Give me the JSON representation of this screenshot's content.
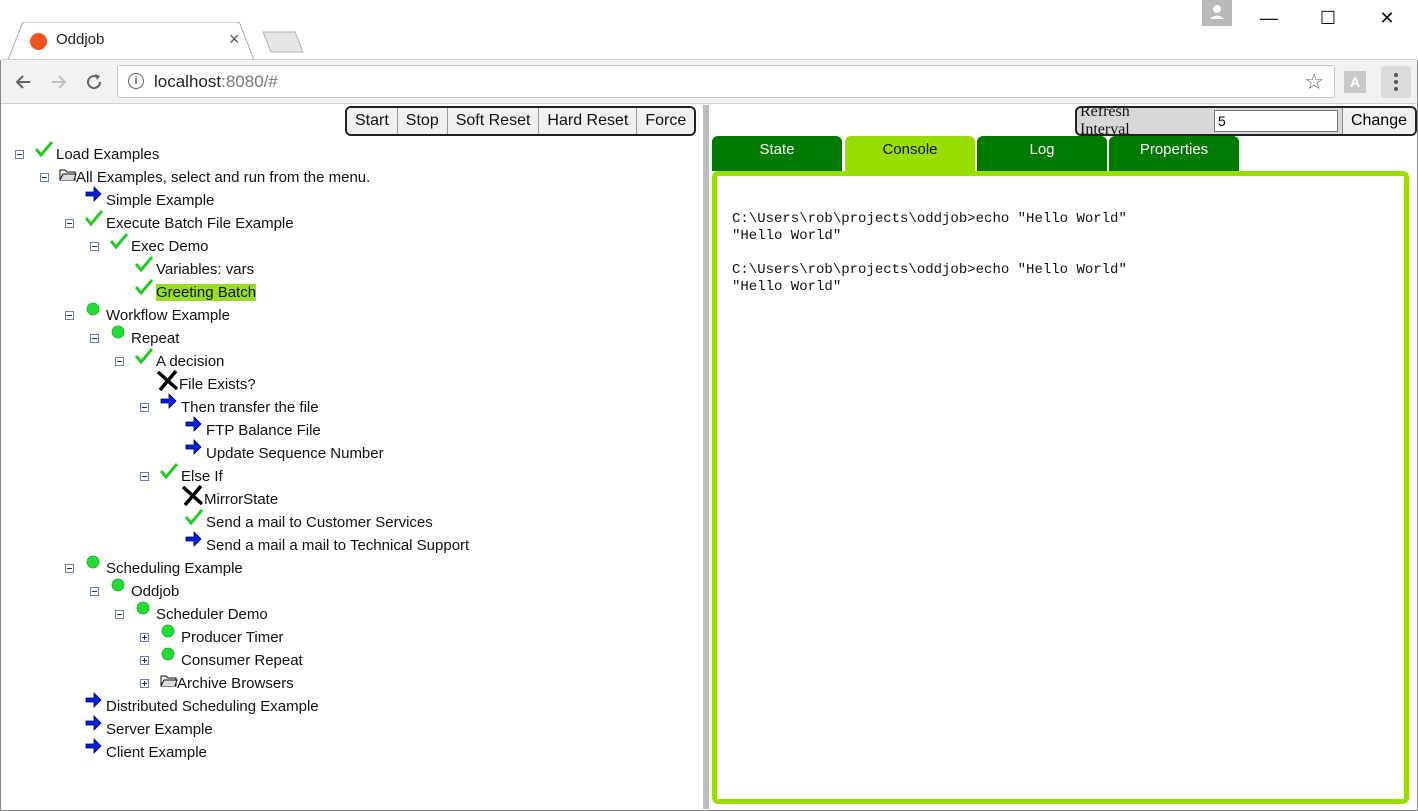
{
  "browser": {
    "tab_title": "Oddjob",
    "tab_close": "×",
    "url_host": "localhost",
    "url_rest": ":8080/#",
    "pdf_label": "A"
  },
  "window": {
    "minimize": "—",
    "maximize": "☐",
    "close": "✕"
  },
  "job_controls": [
    "Start",
    "Stop",
    "Soft Reset",
    "Hard Reset",
    "Force"
  ],
  "tree": [
    {
      "label": "Load Examples",
      "icon": "check-icon",
      "toggle": "minus",
      "selected": false
    },
    {
      "label": "All Examples, select and run from the menu.",
      "icon": "folder-icon",
      "toggle": "minus",
      "selected": false
    },
    {
      "label": "Simple Example",
      "icon": "arrow-icon",
      "toggle": "",
      "selected": false
    },
    {
      "label": "Execute Batch File Example",
      "icon": "check-icon",
      "toggle": "minus",
      "selected": false
    },
    {
      "label": "Exec Demo",
      "icon": "check-icon",
      "toggle": "minus",
      "selected": false
    },
    {
      "label": "Variables: vars",
      "icon": "check-icon",
      "toggle": "",
      "selected": false
    },
    {
      "label": "Greeting Batch",
      "icon": "check-icon",
      "toggle": "",
      "selected": true
    },
    {
      "label": "Workflow Example",
      "icon": "green-dot-icon",
      "toggle": "minus",
      "selected": false
    },
    {
      "label": "Repeat",
      "icon": "green-dot-icon",
      "toggle": "minus",
      "selected": false
    },
    {
      "label": "A decision",
      "icon": "check-icon",
      "toggle": "minus",
      "selected": false
    },
    {
      "label": "File Exists?",
      "icon": "cross-icon",
      "toggle": "",
      "selected": false
    },
    {
      "label": "Then transfer the file",
      "icon": "arrow-icon",
      "toggle": "minus",
      "selected": false
    },
    {
      "label": "FTP Balance File",
      "icon": "arrow-icon",
      "toggle": "",
      "selected": false
    },
    {
      "label": "Update Sequence Number",
      "icon": "arrow-icon",
      "toggle": "",
      "selected": false
    },
    {
      "label": "Else If",
      "icon": "check-icon",
      "toggle": "minus",
      "selected": false
    },
    {
      "label": "MirrorState",
      "icon": "cross-icon",
      "toggle": "",
      "selected": false
    },
    {
      "label": "Send a mail to Customer Services",
      "icon": "check-icon",
      "toggle": "",
      "selected": false
    },
    {
      "label": "Send a mail a mail to Technical Support",
      "icon": "arrow-icon",
      "toggle": "",
      "selected": false
    },
    {
      "label": "Scheduling Example",
      "icon": "green-dot-icon",
      "toggle": "minus",
      "selected": false
    },
    {
      "label": "Oddjob",
      "icon": "green-dot-icon",
      "toggle": "minus",
      "selected": false
    },
    {
      "label": "Scheduler Demo",
      "icon": "green-dot-icon",
      "toggle": "minus",
      "selected": false
    },
    {
      "label": "Producer Timer",
      "icon": "green-dot-icon",
      "toggle": "plus",
      "selected": false
    },
    {
      "label": "Consumer Repeat",
      "icon": "green-dot-icon",
      "toggle": "plus",
      "selected": false
    },
    {
      "label": "Archive Browsers",
      "icon": "folder-icon",
      "toggle": "plus",
      "selected": false
    },
    {
      "label": "Distributed Scheduling Example",
      "icon": "arrow-icon",
      "toggle": "",
      "selected": false
    },
    {
      "label": "Server Example",
      "icon": "arrow-icon",
      "toggle": "",
      "selected": false
    },
    {
      "label": "Client Example",
      "icon": "arrow-icon",
      "toggle": "",
      "selected": false
    }
  ],
  "refresh": {
    "label": "Refresh Interval",
    "value": "5",
    "button": "Change"
  },
  "detail_tabs": [
    {
      "label": "State",
      "active": false
    },
    {
      "label": "Console",
      "active": true
    },
    {
      "label": "Log",
      "active": false
    },
    {
      "label": "Properties",
      "active": false
    }
  ],
  "console_output": "C:\\Users\\rob\\projects\\oddjob>echo \"Hello World\"\n\"Hello World\"\n\nC:\\Users\\rob\\projects\\oddjob>echo \"Hello World\"\n\"Hello World\"",
  "colors": {
    "check": "#22cc22",
    "dot": "#22dd33",
    "arrow": "#0022dd",
    "selected": "#99dd22",
    "tab_green": "#007a00",
    "tab_active": "#99dd00"
  }
}
